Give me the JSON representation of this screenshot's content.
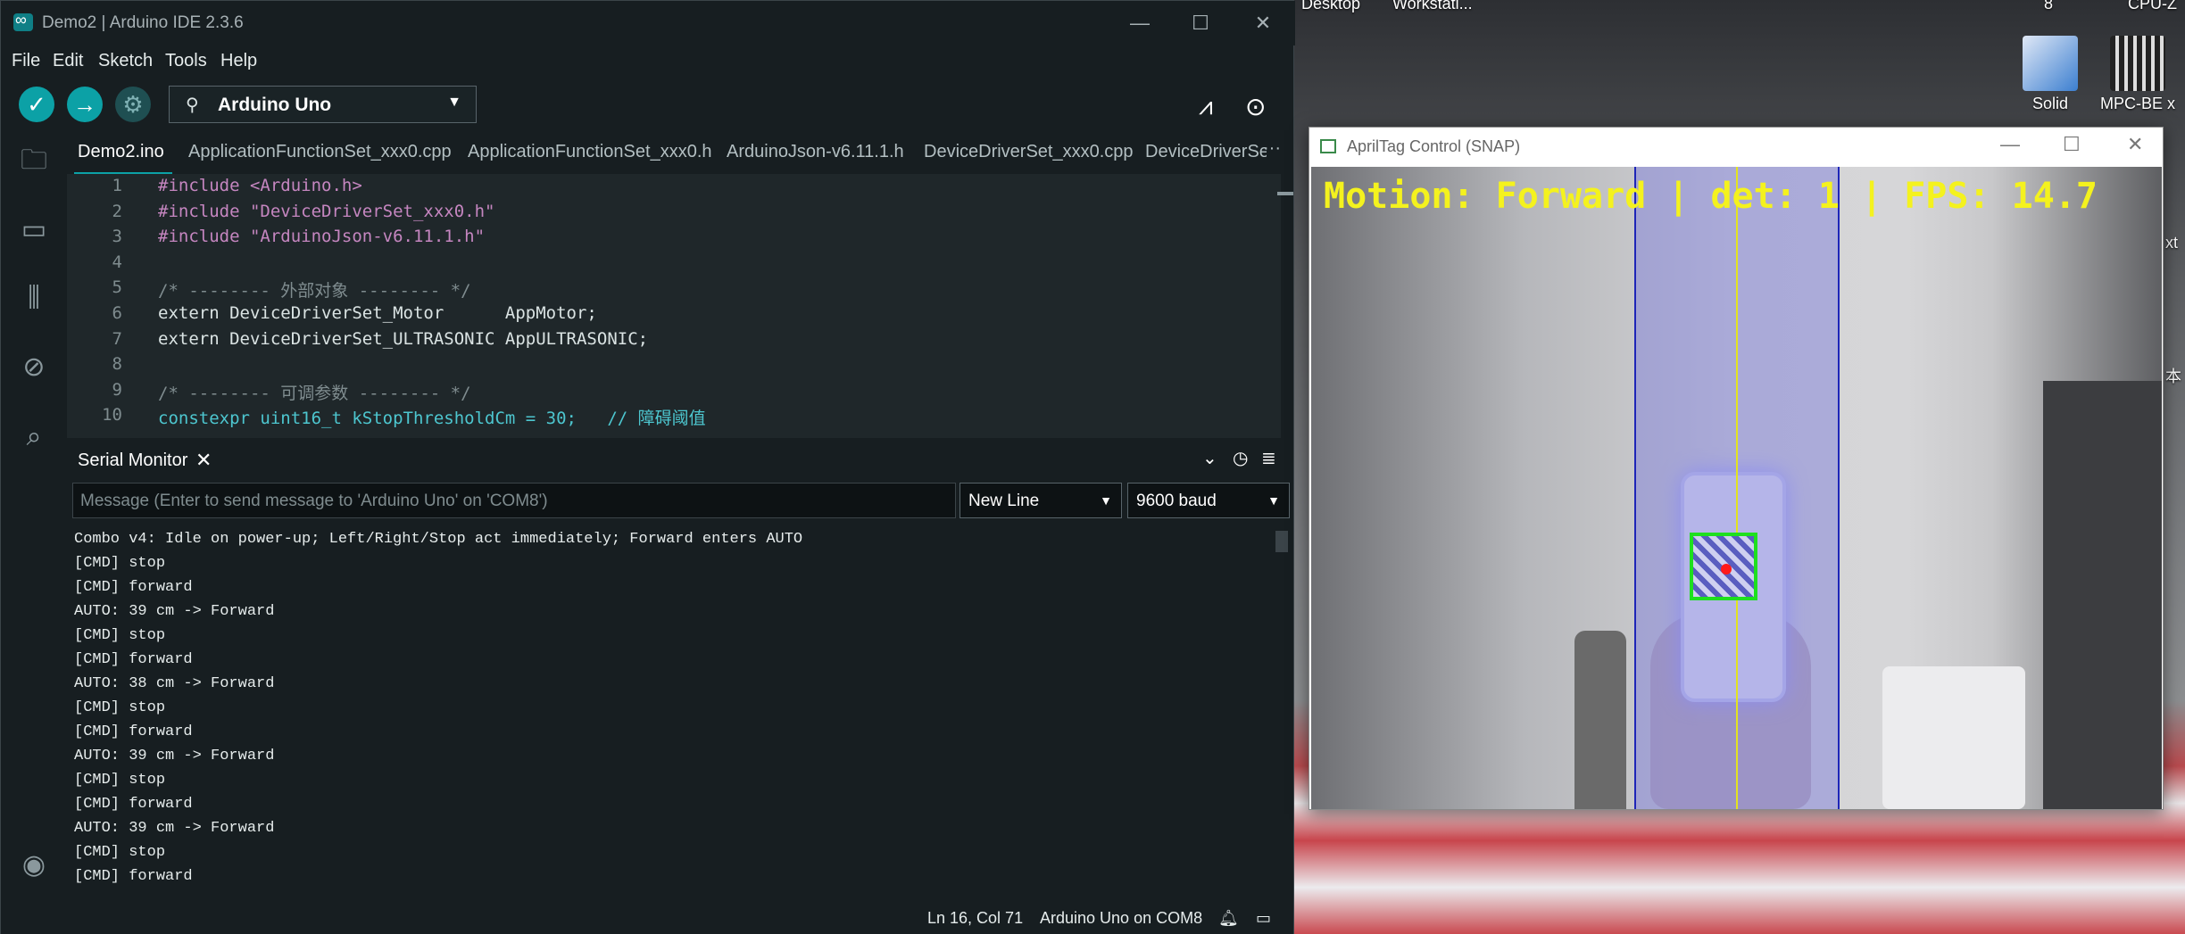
{
  "desktop": {
    "top_labels": [
      "Desktop",
      "Workstati...",
      "8",
      "CPU-Z"
    ],
    "icons": [
      {
        "label": "Solid",
        "icon": "pdf-converter-icon"
      },
      {
        "label": "MPC-BE x",
        "icon": "video-player-icon"
      }
    ],
    "right_edge_text": [
      "xt",
      "本"
    ]
  },
  "ide": {
    "title": "Demo2 | Arduino IDE 2.3.6",
    "window_buttons": {
      "minimize": "—",
      "maximize": "☐",
      "close": "✕"
    },
    "menu": [
      "File",
      "Edit",
      "Sketch",
      "Tools",
      "Help"
    ],
    "board": "Arduino Uno",
    "tabs": [
      "Demo2.ino",
      "ApplicationFunctionSet_xxx0.cpp",
      "ApplicationFunctionSet_xxx0.h",
      "ArduinoJson-v6.11.1.h",
      "DeviceDriverSet_xxx0.cpp",
      "DeviceDriverSe"
    ],
    "tab_more": "···",
    "code_lines": [
      {
        "n": "1",
        "text": "#include <Arduino.h>"
      },
      {
        "n": "2",
        "text": "#include \"DeviceDriverSet_xxx0.h\""
      },
      {
        "n": "3",
        "text": "#include \"ArduinoJson-v6.11.1.h\""
      },
      {
        "n": "4",
        "text": ""
      },
      {
        "n": "5",
        "text": "/* -------- 外部对象 -------- */"
      },
      {
        "n": "6",
        "text": "extern DeviceDriverSet_Motor      AppMotor;"
      },
      {
        "n": "7",
        "text": "extern DeviceDriverSet_ULTRASONIC AppULTRASONIC;"
      },
      {
        "n": "8",
        "text": ""
      },
      {
        "n": "9",
        "text": "/* -------- 可调参数 -------- */"
      },
      {
        "n": "10",
        "text": "constexpr uint16_t kStopThresholdCm = 30;   // 障碍阈值"
      }
    ],
    "serial": {
      "title": "Serial Monitor",
      "message_placeholder": "Message (Enter to send message to 'Arduino Uno' on 'COM8')",
      "line_ending": "New Line",
      "baud": "9600 baud",
      "output": [
        "Combo v4: Idle on power-up; Left/Right/Stop act immediately; Forward enters AUTO",
        "[CMD] stop",
        "[CMD] forward",
        "AUTO: 39 cm -> Forward",
        "[CMD] stop",
        "[CMD] forward",
        "AUTO: 38 cm -> Forward",
        "[CMD] stop",
        "[CMD] forward",
        "AUTO: 39 cm -> Forward",
        "[CMD] stop",
        "[CMD] forward",
        "AUTO: 39 cm -> Forward",
        "[CMD] stop",
        "[CMD] forward"
      ]
    },
    "status": {
      "cursor": "Ln 16, Col 71",
      "port": "Arduino Uno on COM8"
    }
  },
  "apriltag": {
    "title": "AprilTag Control (SNAP)",
    "overlay": "Motion: Forward | det: 1 | FPS: 14.7",
    "colors": {
      "overlay_text": "#f4f21e",
      "tag_box": "#1ee01e",
      "center_line": "#e3e320",
      "band_edge": "#1e25b8"
    }
  }
}
